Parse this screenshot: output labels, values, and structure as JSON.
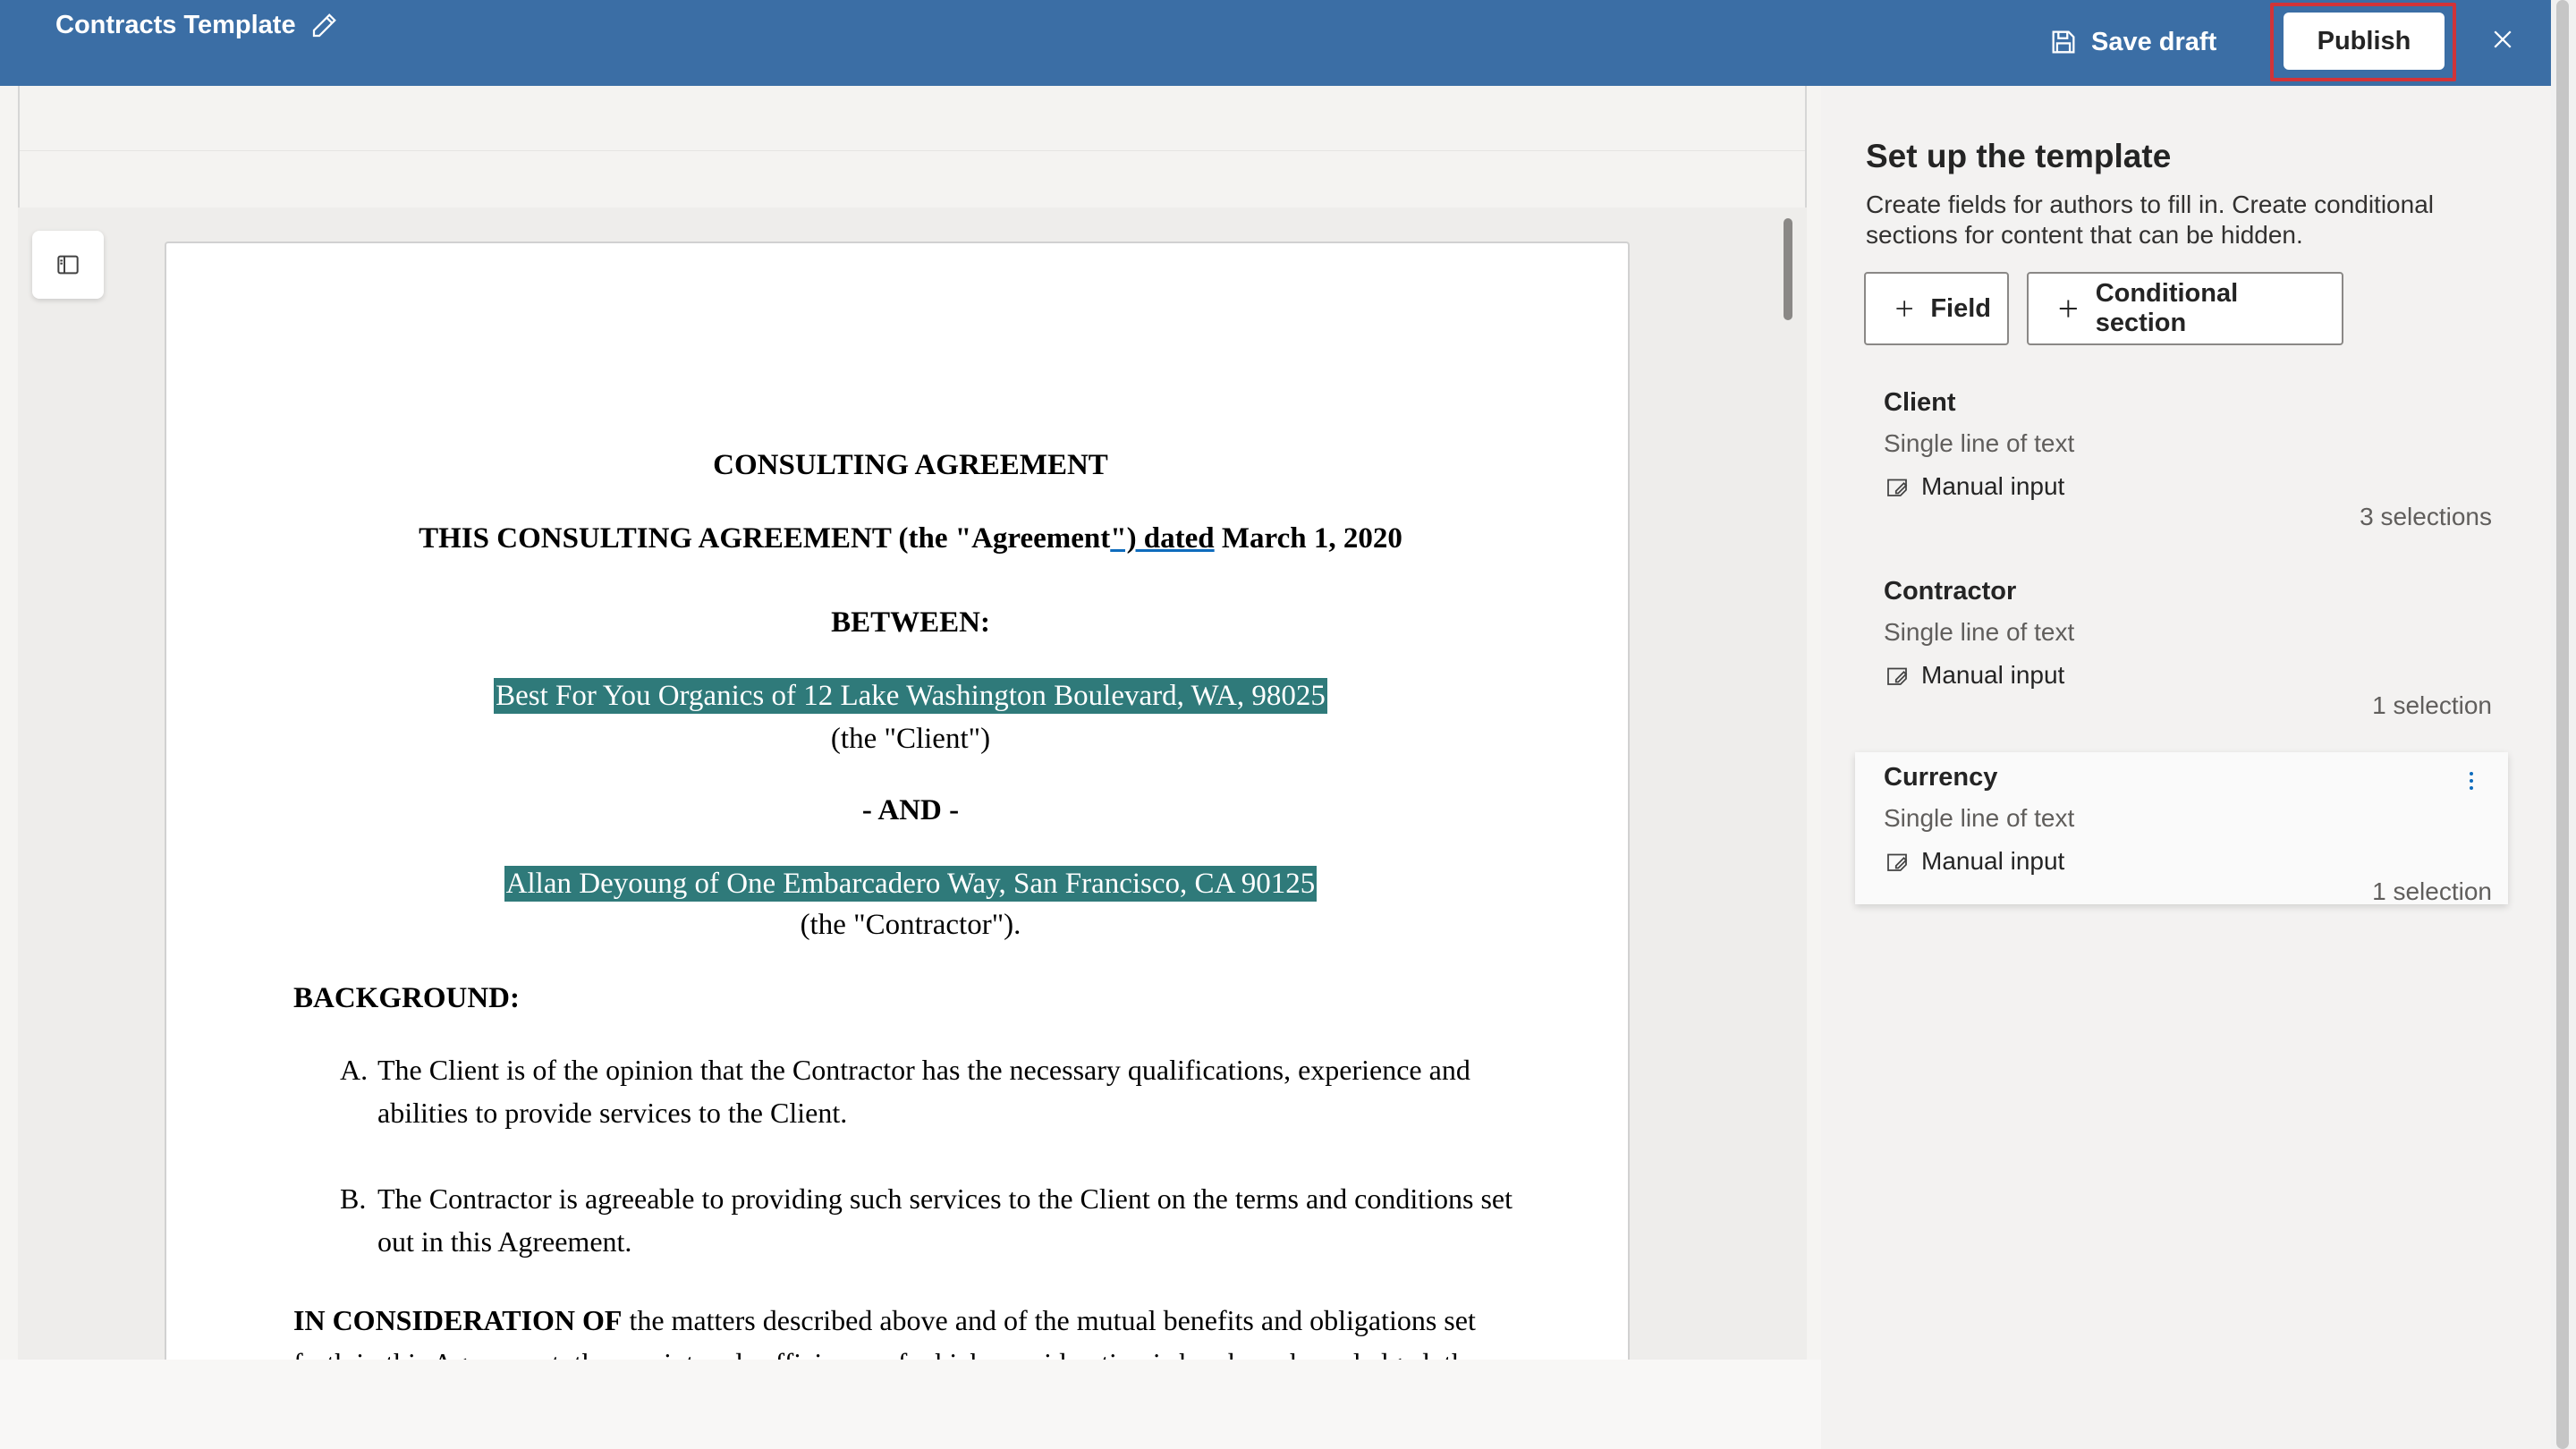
{
  "header": {
    "title": "Contracts Template",
    "save_draft_label": "Save draft",
    "publish_label": "Publish",
    "accent_color": "#3b6ea5",
    "highlight_color": "#d13438"
  },
  "document": {
    "title": "CONSULTING AGREEMENT",
    "subtitle_part1": "THIS CONSULTING AGREEMENT (the \"Agreement",
    "subtitle_underlined": "\") dated",
    "subtitle_part2": " March 1, 2020",
    "between": "BETWEEN:",
    "party1": "Best For You Organics of 12 Lake Washington Boulevard,  WA, 98025",
    "party1_role": "(the \"Client\")",
    "and": "- AND -",
    "party2": "Allan Deyoung of One Embarcadero Way, San Francisco, CA 90125",
    "party2_role": "(the \"Contractor\").",
    "background_heading": "BACKGROUND:",
    "items": [
      {
        "marker": "A.",
        "text": "The Client is of the opinion that the Contractor has the necessary qualifications, experience and abilities to provide services to the Client."
      },
      {
        "marker": "B.",
        "text": "The Contractor is agreeable to providing such services to the Client on the terms and conditions set out in this Agreement."
      }
    ],
    "consideration_bold": "IN CONSIDERATION OF",
    "consideration_text": " the matters described above and of the mutual benefits and obligations set forth in this Agreement, the receipt and sufficiency of which consideration is hereby acknowledged, the",
    "field_highlight_color": "#2f7a7a"
  },
  "panel": {
    "title": "Set up the template",
    "description": "Create fields for authors to fill in. Create conditional sections for content that can be hidden.",
    "add_field_label": "Field",
    "add_conditional_label": "Conditional section",
    "fields": [
      {
        "name": "Client",
        "type": "Single line of text",
        "input": "Manual input",
        "count": "3 selections"
      },
      {
        "name": "Contractor",
        "type": "Single line of text",
        "input": "Manual input",
        "count": "1 selection"
      },
      {
        "name": "Currency",
        "type": "Single line of text",
        "input": "Manual input",
        "count": "1 selection"
      }
    ]
  },
  "icons": {
    "edit": "pencil-icon",
    "save": "save-icon",
    "close": "close-icon",
    "nav": "panel-toggle-icon",
    "add": "plus-icon",
    "input": "manual-input-icon",
    "more": "more-vertical-icon"
  }
}
